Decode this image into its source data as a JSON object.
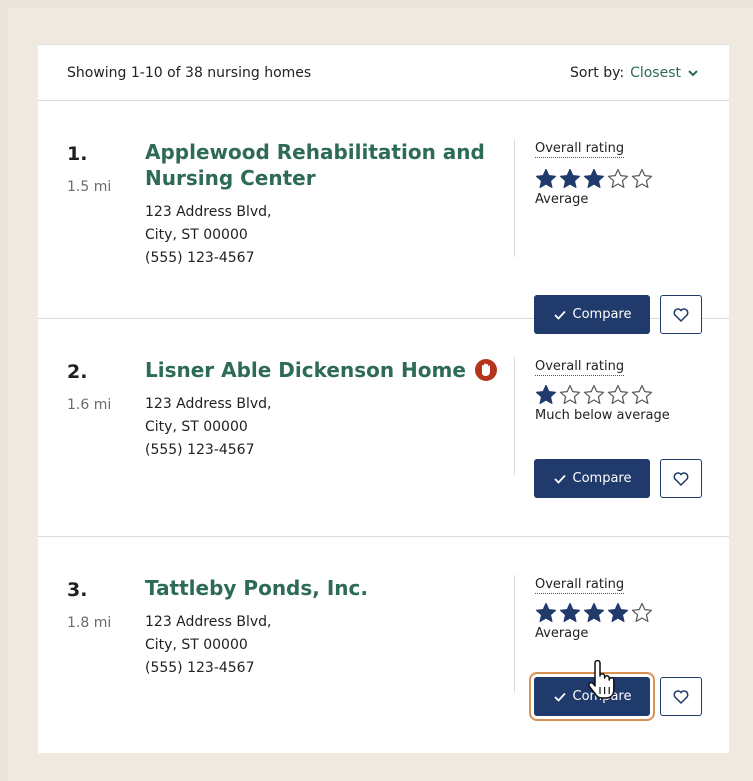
{
  "header": {
    "showing": "Showing 1-10 of 38 nursing homes",
    "sort_label": "Sort by:",
    "sort_value": "Closest"
  },
  "colors": {
    "accent_green": "#2e6b57",
    "primary_navy": "#1f3a6b",
    "alert_red": "#b5341d",
    "focus_orange": "#d99154"
  },
  "facilities": [
    {
      "number": "1.",
      "distance": "1.5 mi",
      "name": "Applewood Rehabilitation and Nursing Center",
      "address_line1": "123 Address Blvd,",
      "address_line2": "City, ST 00000",
      "phone": "(555) 123-4567",
      "rating_label": "Overall rating",
      "stars": 3,
      "rating_text": "Average",
      "compare_label": "Compare",
      "alert_icon": false
    },
    {
      "number": "2.",
      "distance": "1.6 mi",
      "name": "Lisner Able Dickenson Home",
      "address_line1": "123 Address Blvd,",
      "address_line2": "City, ST 00000",
      "phone": "(555) 123-4567",
      "rating_label": "Overall rating",
      "stars": 1,
      "rating_text": "Much below average",
      "compare_label": "Compare",
      "alert_icon": true
    },
    {
      "number": "3.",
      "distance": "1.8 mi",
      "name": "Tattleby Ponds, Inc.",
      "address_line1": "123 Address Blvd,",
      "address_line2": "City, ST 00000",
      "phone": "(555) 123-4567",
      "rating_label": "Overall rating",
      "stars": 4,
      "rating_text": "Average",
      "compare_label": "Compare",
      "alert_icon": false
    }
  ],
  "icons": {
    "sort": "chevron-down-icon",
    "compare": "check-icon",
    "favorite": "heart-icon",
    "alert": "hand-stop-icon",
    "star": "star-icon",
    "cursor": "hand-pointer-icon"
  }
}
